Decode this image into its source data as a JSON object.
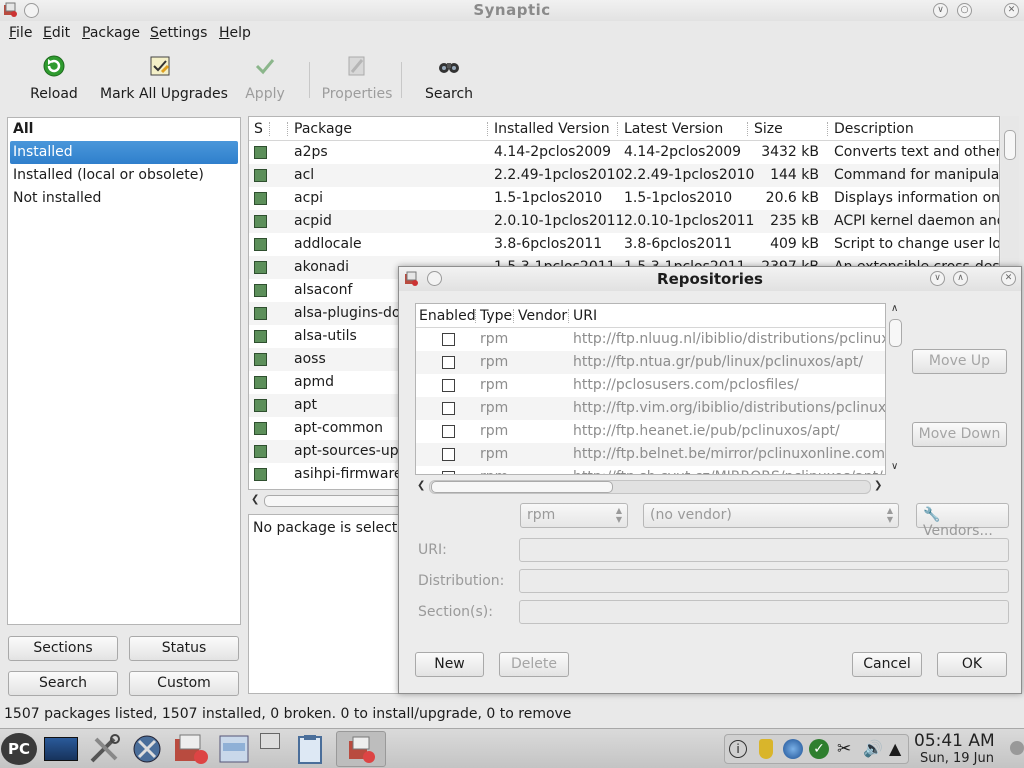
{
  "window": {
    "title": "Synaptic"
  },
  "menu": [
    {
      "label": "File",
      "key": "F",
      "rest": "ile"
    },
    {
      "label": "Edit",
      "key": "E",
      "rest": "dit"
    },
    {
      "label": "Package",
      "key": "P",
      "rest": "ackage"
    },
    {
      "label": "Settings",
      "key": "S",
      "rest": "ettings"
    },
    {
      "label": "Help",
      "key": "H",
      "rest": "elp"
    }
  ],
  "toolbar": {
    "reload": "Reload",
    "mark_all_upgrades": "Mark All Upgrades",
    "apply": "Apply",
    "properties": "Properties",
    "search": "Search"
  },
  "filters": {
    "header": "All",
    "items": [
      "Installed",
      "Installed (local or obsolete)",
      "Not installed"
    ],
    "selected": "Installed"
  },
  "filter_buttons": {
    "sections": "Sections",
    "status": "Status",
    "search": "Search",
    "custom": "Custom"
  },
  "package_table": {
    "columns": {
      "s": "S",
      "package": "Package",
      "installed": "Installed Version",
      "latest": "Latest Version",
      "size": "Size",
      "description": "Description"
    },
    "rows": [
      {
        "name": "a2ps",
        "installed": "4.14-2pclos2009",
        "latest": "4.14-2pclos2009",
        "size": "3432 kB",
        "description": "Converts text and other"
      },
      {
        "name": "acl",
        "installed": "2.2.49-1pclos2010",
        "latest": "2.2.49-1pclos2010",
        "size": "144 kB",
        "description": "Command for manipulati"
      },
      {
        "name": "acpi",
        "installed": "1.5-1pclos2010",
        "latest": "1.5-1pclos2010",
        "size": "20.6 kB",
        "description": "Displays information on A"
      },
      {
        "name": "acpid",
        "installed": "2.0.10-1pclos2011",
        "latest": "2.0.10-1pclos2011",
        "size": "235 kB",
        "description": "ACPI kernel daemon and"
      },
      {
        "name": "addlocale",
        "installed": "3.8-6pclos2011",
        "latest": "3.8-6pclos2011",
        "size": "409 kB",
        "description": "Script to change user loc"
      },
      {
        "name": "akonadi",
        "installed": "1.5.3-1pclos2011",
        "latest": "1.5.3-1pclos2011",
        "size": "2397 kB",
        "description": "An extensible cross-desk"
      },
      {
        "name": "alsaconf",
        "installed": "",
        "latest": "",
        "size": "",
        "description": ""
      },
      {
        "name": "alsa-plugins-doc",
        "installed": "",
        "latest": "",
        "size": "",
        "description": ""
      },
      {
        "name": "alsa-utils",
        "installed": "",
        "latest": "",
        "size": "",
        "description": ""
      },
      {
        "name": "aoss",
        "installed": "",
        "latest": "",
        "size": "",
        "description": ""
      },
      {
        "name": "apmd",
        "installed": "",
        "latest": "",
        "size": "",
        "description": ""
      },
      {
        "name": "apt",
        "installed": "",
        "latest": "",
        "size": "",
        "description": ""
      },
      {
        "name": "apt-common",
        "installed": "",
        "latest": "",
        "size": "",
        "description": ""
      },
      {
        "name": "apt-sources-upd",
        "installed": "",
        "latest": "",
        "size": "",
        "description": ""
      },
      {
        "name": "asihpi-firmware",
        "installed": "",
        "latest": "",
        "size": "",
        "description": ""
      }
    ]
  },
  "description_pane": {
    "text": "No package is selecte"
  },
  "status_bar": {
    "text": "1507 packages listed, 1507 installed, 0 broken. 0 to install/upgrade, 0 to remove"
  },
  "repositories_dialog": {
    "title": "Repositories",
    "columns": {
      "enabled": "Enabled",
      "type": "Type",
      "vendor": "Vendor",
      "uri": "URI"
    },
    "rows": [
      {
        "enabled": false,
        "type": "rpm",
        "vendor": "",
        "uri": "http://ftp.nluug.nl/ibiblio/distributions/pclinuxos"
      },
      {
        "enabled": false,
        "type": "rpm",
        "vendor": "",
        "uri": "http://ftp.ntua.gr/pub/linux/pclinuxos/apt/"
      },
      {
        "enabled": false,
        "type": "rpm",
        "vendor": "",
        "uri": "http://pclosusers.com/pclosfiles/"
      },
      {
        "enabled": false,
        "type": "rpm",
        "vendor": "",
        "uri": "http://ftp.vim.org/ibiblio/distributions/pclinuxos/"
      },
      {
        "enabled": false,
        "type": "rpm",
        "vendor": "",
        "uri": "http://ftp.heanet.ie/pub/pclinuxos/apt/"
      },
      {
        "enabled": false,
        "type": "rpm",
        "vendor": "",
        "uri": "http://ftp.belnet.be/mirror/pclinuxonline.com/a"
      },
      {
        "enabled": false,
        "type": "rpm",
        "vendor": "",
        "uri": "http://ftp.sh.cvut.cz/MIRRORS/pclinuxos/apt/"
      }
    ],
    "move_up": "Move Up",
    "move_down": "Move Down",
    "type_select": "rpm",
    "vendor_select": "(no vendor)",
    "vendors_button": "Vendors...",
    "uri_label": "URI:",
    "distribution_label": "Distribution:",
    "sections_label": "Section(s):",
    "new_button": "New",
    "delete_button": "Delete",
    "cancel_button": "Cancel",
    "ok_button": "OK"
  },
  "taskbar": {
    "start_label": "PC",
    "time": "05:41 AM",
    "date": "Sun, 19 Jun"
  },
  "colors": {
    "selection": "#3a88d3",
    "installed_status": "#5c8f5a",
    "reload_icon": "#2f9b2f"
  }
}
